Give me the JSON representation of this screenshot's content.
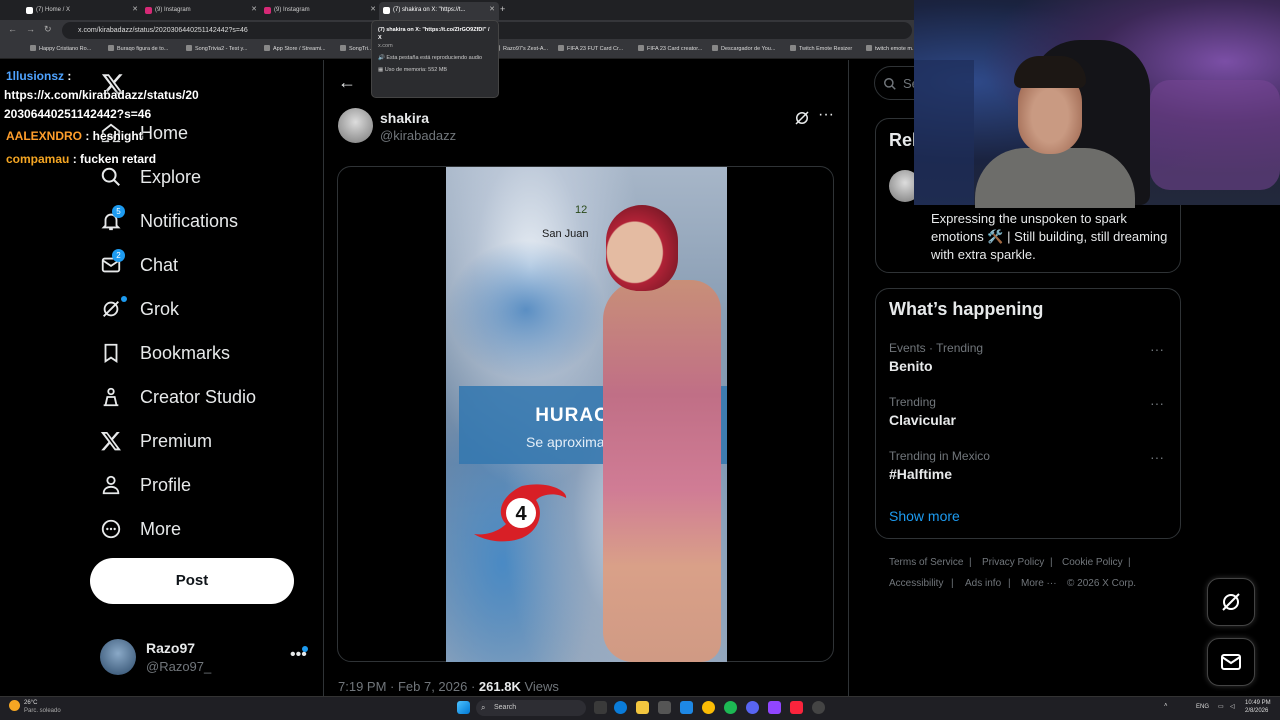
{
  "browser": {
    "tabs": [
      {
        "label": "(7) Home / X",
        "active": false
      },
      {
        "label": "(9) Instagram",
        "active": false
      },
      {
        "label": "(9) Instagram",
        "active": false
      },
      {
        "label": "(7) shakira on X: \"https://t...",
        "active": true
      }
    ],
    "url": "x.com/kirabadazz/status/2020306440251142442?s=46",
    "bookmarks": [
      "Happy Cristiano Ro...",
      "Buraqo figura de to...",
      "SongTrivia2 - Test y...",
      "App Store / Streami...",
      "SongTri...",
      "Razo97's Zest-A...",
      "FIFA 23 FUT Card Cr...",
      "FIFA 23 Card creator...",
      "Descargador de You...",
      "Twitch Emote Resizer",
      "twitch emote m..."
    ],
    "hover_card": {
      "title": "(7) shakira on X: \"https://t.co/ZlrGO9ZfDl\" / X",
      "domain": "x.com",
      "audio": "Esta pestaña está reproduciendo audio",
      "memory": "Uso de memoria: 552 MB"
    }
  },
  "chat": [
    {
      "user": "1llusionsz",
      "user_color": "#4fa3ff",
      "text": " :"
    },
    {
      "user": "",
      "user_color": "#ffffff",
      "text": "https://x.com/kirabadazz/status/20"
    },
    {
      "user": "",
      "user_color": "#ffffff",
      "text": "20306440251142442?s=46"
    },
    {
      "user": "AALEXNDRO",
      "user_color": "#ff9e2c",
      "text": " : heshight"
    },
    {
      "user": "compamau",
      "user_color": "#f5a623",
      "text": " : fucken retard"
    }
  ],
  "sidebar": {
    "items": [
      {
        "label": "Home",
        "icon": "home-icon"
      },
      {
        "label": "Explore",
        "icon": "search-icon"
      },
      {
        "label": "Notifications",
        "icon": "bell-icon",
        "badge": "5"
      },
      {
        "label": "Chat",
        "icon": "mail-icon",
        "badge": "2"
      },
      {
        "label": "Grok",
        "icon": "grok-icon"
      },
      {
        "label": "Bookmarks",
        "icon": "bookmark-icon"
      },
      {
        "label": "Creator Studio",
        "icon": "creator-studio-icon"
      },
      {
        "label": "Premium",
        "icon": "x-logo-icon"
      },
      {
        "label": "Profile",
        "icon": "profile-icon"
      },
      {
        "label": "More",
        "icon": "more-circle-icon"
      }
    ],
    "post_button": "Post",
    "account": {
      "name": "Razo97",
      "handle": "@Razo97_"
    }
  },
  "post": {
    "author_name": "shakira",
    "author_handle": "@kirabadazz",
    "video": {
      "banner_title": "HURACÁN EL",
      "banner_subtitle": "Se aproximará",
      "map_city": "San Juan",
      "map_number": "12",
      "hurricane_category": "4"
    },
    "time": "7:19 PM · Feb 7, 2026 · ",
    "views": "261.8K",
    "views_label": " Views"
  },
  "right": {
    "search_placeholder": "Se",
    "relevant_title": "Rel",
    "relevant_bio": "Expressing the unspoken to spark emotions 🛠️ | Still building, still dreaming with extra sparkle.",
    "whats_happening": "What’s happening",
    "trends": [
      {
        "context": "Events · Trending",
        "name": "Benito"
      },
      {
        "context": "Trending",
        "name": "Clavicular"
      },
      {
        "context": "Trending in Mexico",
        "name": "#Halftime"
      }
    ],
    "show_more": "Show more",
    "footer": [
      "Terms of Service",
      "Privacy Policy",
      "Cookie Policy",
      "Accessibility",
      "Ads info",
      "More ···",
      "© 2026 X Corp."
    ]
  },
  "taskbar": {
    "weather_temp": "26°C",
    "weather_desc": "Parc. soleado",
    "search_label": "Search",
    "lang": "ENG",
    "time": "10:49 PM",
    "date": "2/8/2026"
  }
}
